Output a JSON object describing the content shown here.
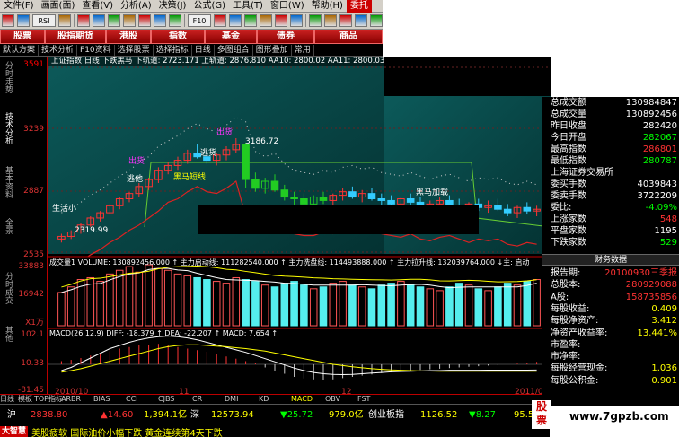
{
  "menubar": {
    "items": [
      "文件(F)",
      "画面(面)",
      "查看(V)",
      "分析(A)",
      "决策(J)",
      "公式(G)",
      "工具(T)",
      "窗口(W)",
      "帮助(H)",
      "委托"
    ]
  },
  "toolbar": {
    "buttons": [
      "new-doc-icon",
      "chart-icon",
      "rsi-icon",
      "list-icon",
      "grid-icon",
      "gauge-icon",
      "bars-icon",
      "bars2-icon",
      "pen-icon",
      "flag-icon",
      "info-icon",
      "f10-icon",
      "search-icon",
      "alert-icon",
      "star-icon",
      "arrow-up-icon",
      "arrow-down-icon",
      "zoom-icon",
      "settings-icon",
      "refresh-icon",
      "print-icon",
      "help-icon",
      "exit-icon"
    ],
    "rsi_label": "RSI",
    "f10_label": "F10"
  },
  "navtabs": [
    "股票",
    "股指期货",
    "港股",
    "指数",
    "基金",
    "债券",
    "商品"
  ],
  "subtool": [
    "默认方案",
    "技术分析",
    "F10资料",
    "选择股票",
    "选择指标",
    "日线",
    "多图组合",
    "图形叠加",
    "常用"
  ],
  "leftbar": [
    "分时走势",
    "技术分析",
    "基本资料",
    "全景",
    "分时成交",
    "其他"
  ],
  "yaxis": {
    "price": [
      "3591",
      "3239",
      "2887",
      "2535"
    ],
    "volume": [
      "33883",
      "16942",
      "X1万"
    ],
    "macd": [
      "102.1",
      "10.33",
      "-81.45"
    ]
  },
  "chart_info": {
    "top": "上证指数 日线  下跌黑马  下轨道: 2723.171 上轨道: 2876.810 AA10: 2800.02 AA11: 2800.03",
    "volume": "成交量1 VOLUME: 130892456.000 ↑  主力启动线: 111282540.000 ↑  主力洗盘线: 114493888.000 ↑  主力拉升线: 132039764.000  ↓主: 启动",
    "macd": "MACD(26,12,9)  DIFF: -18.379 ↑ DEA: -22.207 ↑ MACD: 7.654 ↑",
    "labels": {
      "high_price": "3186.72",
      "low_price": "2319.99",
      "chuhuo1": "出货",
      "chuhuo2": "出货",
      "taohuo": "逃货",
      "taozhu": "逃他",
      "heima": "黑马短线",
      "xuanxi": "生活小",
      "heima2": "黑马加载"
    }
  },
  "chart_data": {
    "type": "candlestick",
    "title": "上证指数 日线",
    "ylim": [
      2535,
      3591
    ],
    "ylabel": "",
    "xlabel": "",
    "x": [
      "2010/10",
      "11",
      "12",
      "2011/01"
    ],
    "candles": [
      [
        2610,
        2640,
        2590,
        2625
      ],
      [
        2625,
        2660,
        2610,
        2650
      ],
      [
        2650,
        2700,
        2640,
        2690
      ],
      [
        2690,
        2740,
        2680,
        2730
      ],
      [
        2730,
        2770,
        2710,
        2760
      ],
      [
        2760,
        2810,
        2750,
        2800
      ],
      [
        2800,
        2850,
        2780,
        2840
      ],
      [
        2840,
        2880,
        2820,
        2870
      ],
      [
        2870,
        2930,
        2850,
        2910
      ],
      [
        2910,
        2960,
        2890,
        2950
      ],
      [
        2950,
        3020,
        2930,
        3000
      ],
      [
        3000,
        3050,
        2980,
        3030
      ],
      [
        3030,
        3080,
        3000,
        3060
      ],
      [
        3060,
        3120,
        3040,
        3100
      ],
      [
        3100,
        3150,
        3070,
        3080
      ],
      [
        3080,
        3120,
        3040,
        3060
      ],
      [
        3060,
        3100,
        3030,
        3090
      ],
      [
        3090,
        3140,
        3060,
        3120
      ],
      [
        3120,
        3186,
        3100,
        3150
      ],
      [
        3150,
        3160,
        2900,
        2950
      ],
      [
        2950,
        2990,
        2880,
        2900
      ],
      [
        2900,
        2960,
        2870,
        2940
      ],
      [
        2940,
        2980,
        2880,
        2890
      ],
      [
        2890,
        2920,
        2830,
        2850
      ],
      [
        2850,
        2880,
        2800,
        2840
      ],
      [
        2840,
        2870,
        2790,
        2810
      ],
      [
        2810,
        2860,
        2790,
        2850
      ],
      [
        2850,
        2880,
        2810,
        2830
      ],
      [
        2830,
        2870,
        2800,
        2860
      ],
      [
        2860,
        2900,
        2830,
        2880
      ],
      [
        2880,
        2910,
        2840,
        2850
      ],
      [
        2850,
        2890,
        2820,
        2870
      ],
      [
        2870,
        2900,
        2830,
        2840
      ],
      [
        2840,
        2870,
        2800,
        2830
      ],
      [
        2830,
        2860,
        2790,
        2810
      ],
      [
        2810,
        2850,
        2780,
        2840
      ],
      [
        2840,
        2870,
        2800,
        2820
      ],
      [
        2820,
        2850,
        2770,
        2790
      ],
      [
        2790,
        2830,
        2760,
        2810
      ],
      [
        2810,
        2850,
        2780,
        2830
      ],
      [
        2830,
        2860,
        2790,
        2800
      ],
      [
        2800,
        2840,
        2770,
        2780
      ],
      [
        2780,
        2820,
        2750,
        2810
      ],
      [
        2810,
        2840,
        2770,
        2790
      ],
      [
        2790,
        2830,
        2760,
        2800
      ],
      [
        2800,
        2840,
        2770,
        2780
      ],
      [
        2780,
        2810,
        2740,
        2760
      ],
      [
        2760,
        2800,
        2730,
        2790
      ],
      [
        2790,
        2820,
        2750,
        2770
      ],
      [
        2770,
        2800,
        2740,
        2780
      ]
    ],
    "volume": [
      180,
      210,
      250,
      260,
      240,
      280,
      300,
      320,
      290,
      330,
      310,
      300,
      280,
      270,
      260,
      250,
      240,
      230,
      260,
      250,
      240,
      220,
      210,
      230,
      240,
      220,
      200,
      210,
      230,
      240,
      220,
      210,
      200,
      220,
      230,
      240,
      220,
      210,
      200,
      190,
      210,
      230,
      220,
      200,
      190,
      210,
      230,
      220,
      240,
      250
    ],
    "macd_hist": [
      10,
      14,
      20,
      28,
      35,
      42,
      50,
      55,
      60,
      62,
      65,
      60,
      55,
      50,
      45,
      40,
      32,
      25,
      18,
      10,
      5,
      -10,
      -20,
      -30,
      -40,
      -45,
      -48,
      -50,
      -48,
      -44,
      -40,
      -36,
      -32,
      -28,
      -25,
      -22,
      -20,
      -18,
      -16,
      -14,
      -12,
      -10,
      -8,
      -6,
      -4,
      -2,
      0,
      2,
      4,
      7.654
    ],
    "diff": [
      -20,
      -10,
      5,
      20,
      35,
      50,
      60,
      70,
      78,
      84,
      88,
      90,
      88,
      84,
      78,
      70,
      62,
      54,
      46,
      38,
      28,
      18,
      8,
      -2,
      -12,
      -20,
      -26,
      -30,
      -32,
      -33,
      -32,
      -30,
      -28,
      -26,
      -24,
      -23,
      -22,
      -21,
      -20,
      -20,
      -19,
      -19,
      -19,
      -19,
      -18.5,
      -18.5,
      -18.4,
      -18.4,
      -18.4,
      -18.379
    ],
    "dea": [
      -25,
      -20,
      -14,
      -6,
      2,
      10,
      18,
      26,
      34,
      42,
      50,
      56,
      60,
      62,
      62,
      60,
      58,
      56,
      53,
      50,
      46,
      42,
      36,
      30,
      24,
      18,
      12,
      6,
      0,
      -4,
      -8,
      -11,
      -14,
      -16,
      -18,
      -19,
      -20,
      -21,
      -21.5,
      -22,
      -22,
      -22.1,
      -22.2,
      -22.2,
      -22.2,
      -22.2,
      -22.2,
      -22.2,
      -22.2,
      -22.207
    ]
  },
  "right_info": {
    "rows": [
      {
        "label": "总成交额",
        "value": "130984847",
        "color": "w"
      },
      {
        "label": "总成交量",
        "value": "130892456",
        "color": "w"
      },
      {
        "label": "昨日收盘",
        "value": "282420",
        "color": "w"
      },
      {
        "label": "今日开盘",
        "value": "282067",
        "color": "g"
      },
      {
        "label": "最高指数",
        "value": "286801",
        "color": "r"
      },
      {
        "label": "最低指数",
        "value": "280787",
        "color": "g"
      },
      {
        "label": "上海证券交易所",
        "value": "",
        "color": "w"
      },
      {
        "label": "委买手数",
        "value": "4039843",
        "color": "w"
      },
      {
        "label": "委卖手数",
        "value": "3722209",
        "color": "w"
      },
      {
        "label": "委比:",
        "value": "-4.09%",
        "color": "g"
      },
      {
        "label": "上涨家数",
        "value": "548",
        "color": "r"
      },
      {
        "label": "平盘家数",
        "value": "1195",
        "color": "w"
      },
      {
        "label": "下跌家数",
        "value": "529",
        "color": "g"
      }
    ],
    "section_title": "财务数据",
    "fin": [
      {
        "label": "报告期:",
        "value": "20100930三季报",
        "color": "r"
      },
      {
        "label": "总股本:",
        "value": "280929088",
        "color": "r"
      },
      {
        "label": "A股:",
        "value": "158735856",
        "color": "r"
      },
      {
        "label": "每股收益:",
        "value": "0.409",
        "color": "y"
      },
      {
        "label": "每股净资产:",
        "value": "3.412",
        "color": "y"
      },
      {
        "label": "净资产收益率:",
        "value": "13.441%",
        "color": "y"
      },
      {
        "label": "市盈率:",
        "value": "",
        "color": "y"
      },
      {
        "label": "市净率:",
        "value": "",
        "color": "y"
      },
      {
        "label": "每股经营现金:",
        "value": "1.036",
        "color": "y"
      },
      {
        "label": "每股公积金:",
        "value": "0.901",
        "color": "y"
      }
    ]
  },
  "panel_tabs": [
    "日线",
    "模板",
    "TOP指标",
    "ARBR",
    "BIAS",
    "CCI",
    "CJBS",
    "CR",
    "DMI",
    "KD",
    "MACD",
    "OBV",
    "FST"
  ],
  "xaxis": [
    "2010/10",
    "11",
    "12",
    "2011/01"
  ],
  "quotes": {
    "sh_label": "沪",
    "sh_price": "2838.80",
    "sh_change": "▲14.60",
    "sh_amount": "1,394.1亿",
    "sz_label": "深",
    "sz_price": "12573.94",
    "sz_change": "▼25.72",
    "sz_amount": "979.0亿",
    "cy_label": "创业板指",
    "cy_price": "1126.52",
    "cy_change": "▼8.27",
    "cy_extra": "95.5"
  },
  "ticker": {
    "label": "大智慧",
    "text": "美股疲软 国际油价小幅下跌 黄金连续第4天下跌"
  },
  "watermark": {
    "url": "www.7gpzb.com",
    "logo": "股票"
  }
}
